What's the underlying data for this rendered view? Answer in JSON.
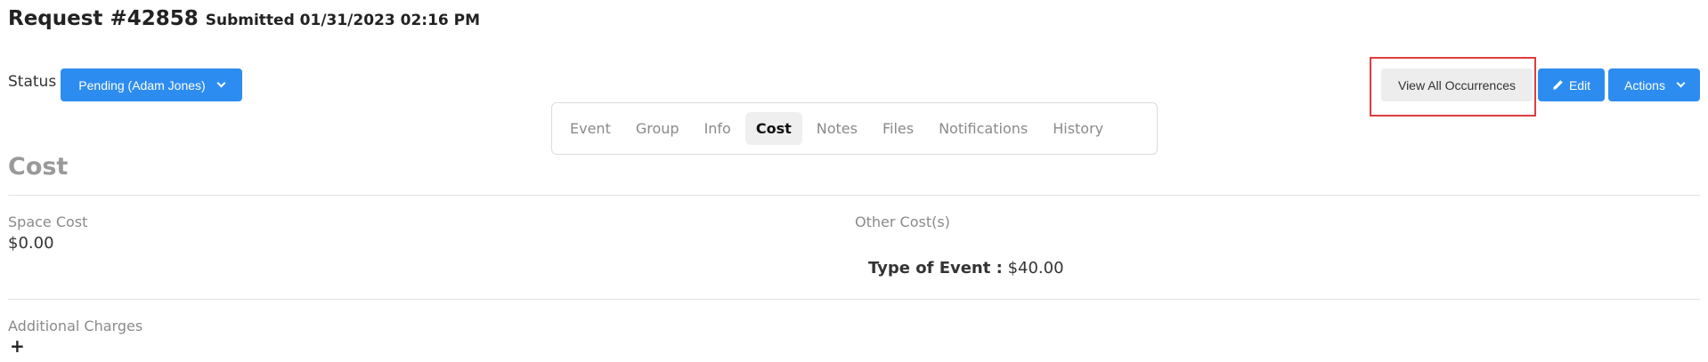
{
  "header": {
    "title": "Request #42858",
    "submitted": "Submitted 01/31/2023 02:16 PM"
  },
  "status": {
    "label": "Status",
    "value": "Pending (Adam Jones)"
  },
  "tabs": [
    {
      "label": "Event",
      "active": false
    },
    {
      "label": "Group",
      "active": false
    },
    {
      "label": "Info",
      "active": false
    },
    {
      "label": "Cost",
      "active": true
    },
    {
      "label": "Notes",
      "active": false
    },
    {
      "label": "Files",
      "active": false
    },
    {
      "label": "Notifications",
      "active": false
    },
    {
      "label": "History",
      "active": false
    }
  ],
  "toolbar": {
    "view_occurrences": "View All Occurrences",
    "edit": "Edit",
    "actions": "Actions"
  },
  "cost": {
    "section_title": "Cost",
    "space_cost_label": "Space Cost",
    "space_cost_value": "$0.00",
    "other_costs_label": "Other Cost(s)",
    "type_of_event_label": "Type of Event :",
    "type_of_event_value": "$40.00",
    "additional_charges_label": "Additional Charges",
    "add_symbol": "+"
  },
  "icons": {
    "status_dropdown": "chevron-down-icon",
    "edit": "pencil-icon",
    "actions_dropdown": "chevron-down-icon"
  },
  "colors": {
    "primary": "#2d8cf0",
    "highlight_border": "#e03c3c"
  }
}
